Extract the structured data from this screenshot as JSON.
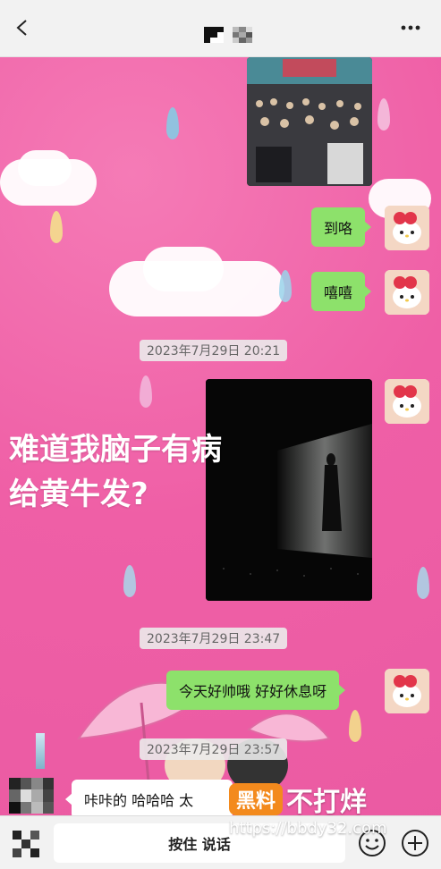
{
  "messages": {
    "msg1": "到咯",
    "msg2": "嘻嘻",
    "ts1": "2023年7月29日 20:21",
    "photo_caption_line1": "难道我脑子有病",
    "photo_caption_line2": "给黄牛发?",
    "ts2": "2023年7月29日 23:47",
    "msg3": "今天好帅哦 好好休息呀",
    "ts3": "2023年7月29日 23:57",
    "reply": "咔咔的 哈哈哈 太"
  },
  "bottom": {
    "voice_label": "按住 说话"
  },
  "watermark": {
    "badge": "黑料",
    "text": "不打烊",
    "url": "https://bbdy32.com"
  },
  "colors": {
    "background": "#ef5fa6",
    "my_bubble": "#8de16b",
    "their_bubble": "#ffffff",
    "header": "#f2f2f2"
  }
}
